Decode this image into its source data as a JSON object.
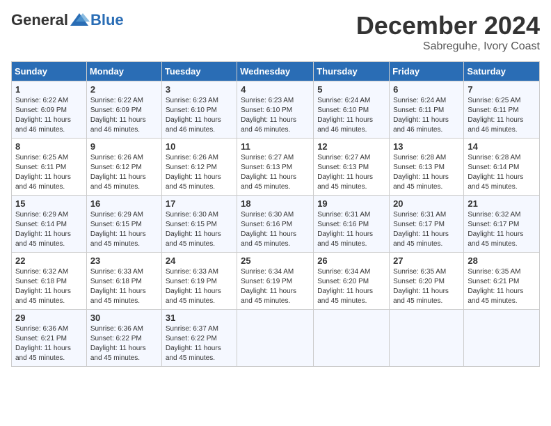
{
  "logo": {
    "general": "General",
    "blue": "Blue"
  },
  "header": {
    "month": "December 2024",
    "location": "Sabreguhe, Ivory Coast"
  },
  "weekdays": [
    "Sunday",
    "Monday",
    "Tuesday",
    "Wednesday",
    "Thursday",
    "Friday",
    "Saturday"
  ],
  "weeks": [
    [
      {
        "day": "1",
        "sunrise": "6:22 AM",
        "sunset": "6:09 PM",
        "daylight": "11 hours and 46 minutes."
      },
      {
        "day": "2",
        "sunrise": "6:22 AM",
        "sunset": "6:09 PM",
        "daylight": "11 hours and 46 minutes."
      },
      {
        "day": "3",
        "sunrise": "6:23 AM",
        "sunset": "6:10 PM",
        "daylight": "11 hours and 46 minutes."
      },
      {
        "day": "4",
        "sunrise": "6:23 AM",
        "sunset": "6:10 PM",
        "daylight": "11 hours and 46 minutes."
      },
      {
        "day": "5",
        "sunrise": "6:24 AM",
        "sunset": "6:10 PM",
        "daylight": "11 hours and 46 minutes."
      },
      {
        "day": "6",
        "sunrise": "6:24 AM",
        "sunset": "6:11 PM",
        "daylight": "11 hours and 46 minutes."
      },
      {
        "day": "7",
        "sunrise": "6:25 AM",
        "sunset": "6:11 PM",
        "daylight": "11 hours and 46 minutes."
      }
    ],
    [
      {
        "day": "8",
        "sunrise": "6:25 AM",
        "sunset": "6:11 PM",
        "daylight": "11 hours and 46 minutes."
      },
      {
        "day": "9",
        "sunrise": "6:26 AM",
        "sunset": "6:12 PM",
        "daylight": "11 hours and 45 minutes."
      },
      {
        "day": "10",
        "sunrise": "6:26 AM",
        "sunset": "6:12 PM",
        "daylight": "11 hours and 45 minutes."
      },
      {
        "day": "11",
        "sunrise": "6:27 AM",
        "sunset": "6:13 PM",
        "daylight": "11 hours and 45 minutes."
      },
      {
        "day": "12",
        "sunrise": "6:27 AM",
        "sunset": "6:13 PM",
        "daylight": "11 hours and 45 minutes."
      },
      {
        "day": "13",
        "sunrise": "6:28 AM",
        "sunset": "6:13 PM",
        "daylight": "11 hours and 45 minutes."
      },
      {
        "day": "14",
        "sunrise": "6:28 AM",
        "sunset": "6:14 PM",
        "daylight": "11 hours and 45 minutes."
      }
    ],
    [
      {
        "day": "15",
        "sunrise": "6:29 AM",
        "sunset": "6:14 PM",
        "daylight": "11 hours and 45 minutes."
      },
      {
        "day": "16",
        "sunrise": "6:29 AM",
        "sunset": "6:15 PM",
        "daylight": "11 hours and 45 minutes."
      },
      {
        "day": "17",
        "sunrise": "6:30 AM",
        "sunset": "6:15 PM",
        "daylight": "11 hours and 45 minutes."
      },
      {
        "day": "18",
        "sunrise": "6:30 AM",
        "sunset": "6:16 PM",
        "daylight": "11 hours and 45 minutes."
      },
      {
        "day": "19",
        "sunrise": "6:31 AM",
        "sunset": "6:16 PM",
        "daylight": "11 hours and 45 minutes."
      },
      {
        "day": "20",
        "sunrise": "6:31 AM",
        "sunset": "6:17 PM",
        "daylight": "11 hours and 45 minutes."
      },
      {
        "day": "21",
        "sunrise": "6:32 AM",
        "sunset": "6:17 PM",
        "daylight": "11 hours and 45 minutes."
      }
    ],
    [
      {
        "day": "22",
        "sunrise": "6:32 AM",
        "sunset": "6:18 PM",
        "daylight": "11 hours and 45 minutes."
      },
      {
        "day": "23",
        "sunrise": "6:33 AM",
        "sunset": "6:18 PM",
        "daylight": "11 hours and 45 minutes."
      },
      {
        "day": "24",
        "sunrise": "6:33 AM",
        "sunset": "6:19 PM",
        "daylight": "11 hours and 45 minutes."
      },
      {
        "day": "25",
        "sunrise": "6:34 AM",
        "sunset": "6:19 PM",
        "daylight": "11 hours and 45 minutes."
      },
      {
        "day": "26",
        "sunrise": "6:34 AM",
        "sunset": "6:20 PM",
        "daylight": "11 hours and 45 minutes."
      },
      {
        "day": "27",
        "sunrise": "6:35 AM",
        "sunset": "6:20 PM",
        "daylight": "11 hours and 45 minutes."
      },
      {
        "day": "28",
        "sunrise": "6:35 AM",
        "sunset": "6:21 PM",
        "daylight": "11 hours and 45 minutes."
      }
    ],
    [
      {
        "day": "29",
        "sunrise": "6:36 AM",
        "sunset": "6:21 PM",
        "daylight": "11 hours and 45 minutes."
      },
      {
        "day": "30",
        "sunrise": "6:36 AM",
        "sunset": "6:22 PM",
        "daylight": "11 hours and 45 minutes."
      },
      {
        "day": "31",
        "sunrise": "6:37 AM",
        "sunset": "6:22 PM",
        "daylight": "11 hours and 45 minutes."
      },
      null,
      null,
      null,
      null
    ]
  ],
  "labels": {
    "sunrise": "Sunrise:",
    "sunset": "Sunset:",
    "daylight": "Daylight:"
  }
}
